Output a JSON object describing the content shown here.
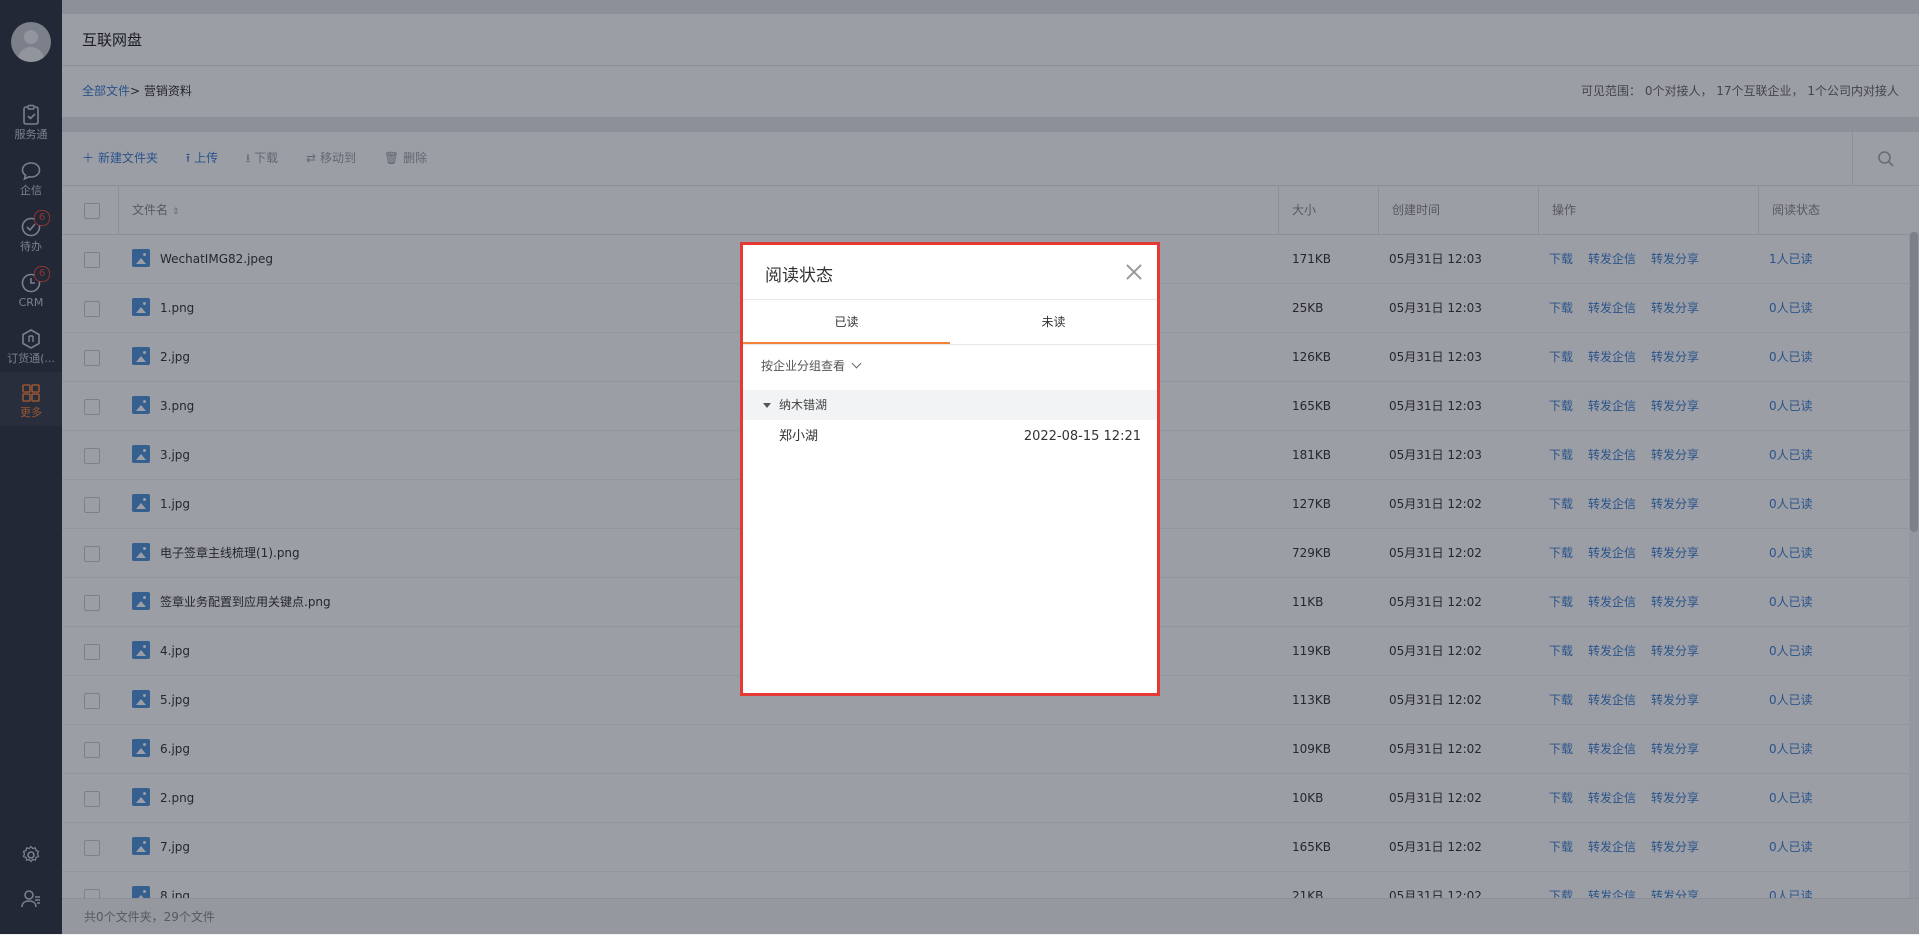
{
  "sidebar": {
    "items": [
      {
        "label": "服务通",
        "icon": "clipboard-icon",
        "badge": ""
      },
      {
        "label": "企信",
        "icon": "chat-bubble-icon",
        "badge": ""
      },
      {
        "label": "待办",
        "icon": "check-circle-icon",
        "badge": "6"
      },
      {
        "label": "CRM",
        "icon": "clock-icon",
        "badge": "6"
      },
      {
        "label": "订货通(...",
        "icon": "order-icon",
        "badge": ""
      },
      {
        "label": "更多",
        "icon": "grid-icon",
        "badge": ""
      }
    ],
    "bottom": [
      "gear-icon",
      "user-settings-icon"
    ]
  },
  "header": {
    "title": "互联网盘"
  },
  "breadcrumb": {
    "root": "全部文件",
    "separator": ">",
    "current": "营销资料"
  },
  "visibility": "可见范围： 0个对接人， 17个互联企业， 1个公司内对接人",
  "toolbar": {
    "new_folder": "新建文件夹",
    "upload": "上传",
    "download": "下载",
    "move": "移动到",
    "delete": "删除"
  },
  "table": {
    "headers": {
      "name": "文件名",
      "size": "大小",
      "created": "创建时间",
      "actions": "操作",
      "read_status": "阅读状态"
    },
    "action_labels": {
      "download": "下载",
      "forward_msg": "转发企信",
      "forward_share": "转发分享"
    },
    "rows": [
      {
        "name": "WechatIMG82.jpeg",
        "size": "171KB",
        "created": "05月31日 12:03",
        "read": "1人已读"
      },
      {
        "name": "1.png",
        "size": "25KB",
        "created": "05月31日 12:03",
        "read": "0人已读"
      },
      {
        "name": "2.jpg",
        "size": "126KB",
        "created": "05月31日 12:03",
        "read": "0人已读"
      },
      {
        "name": "3.png",
        "size": "165KB",
        "created": "05月31日 12:03",
        "read": "0人已读"
      },
      {
        "name": "3.jpg",
        "size": "181KB",
        "created": "05月31日 12:03",
        "read": "0人已读"
      },
      {
        "name": "1.jpg",
        "size": "127KB",
        "created": "05月31日 12:02",
        "read": "0人已读"
      },
      {
        "name": "电子签章主线梳理(1).png",
        "size": "729KB",
        "created": "05月31日 12:02",
        "read": "0人已读"
      },
      {
        "name": "签章业务配置到应用关键点.png",
        "size": "11KB",
        "created": "05月31日 12:02",
        "read": "0人已读"
      },
      {
        "name": "4.jpg",
        "size": "119KB",
        "created": "05月31日 12:02",
        "read": "0人已读"
      },
      {
        "name": "5.jpg",
        "size": "113KB",
        "created": "05月31日 12:02",
        "read": "0人已读"
      },
      {
        "name": "6.jpg",
        "size": "109KB",
        "created": "05月31日 12:02",
        "read": "0人已读"
      },
      {
        "name": "2.png",
        "size": "10KB",
        "created": "05月31日 12:02",
        "read": "0人已读"
      },
      {
        "name": "7.jpg",
        "size": "165KB",
        "created": "05月31日 12:02",
        "read": "0人已读"
      },
      {
        "name": "8.jpg",
        "size": "21KB",
        "created": "05月31日 12:02",
        "read": "0人已读"
      }
    ]
  },
  "footer": "共0个文件夹，29个文件",
  "modal": {
    "title": "阅读状态",
    "tabs": [
      "已读",
      "未读"
    ],
    "active_tab": "已读",
    "group_by": "按企业分组查看",
    "group_name": "纳木错湖",
    "readers": [
      {
        "name": "郑小湖",
        "time": "2022-08-15 12:21"
      }
    ]
  },
  "colors": {
    "accent": "#3a7ed2",
    "tab_active": "#f2833b",
    "sidebar_bg": "#2f3440",
    "badge": "#e24b3b",
    "highlight_border": "#e53935"
  }
}
